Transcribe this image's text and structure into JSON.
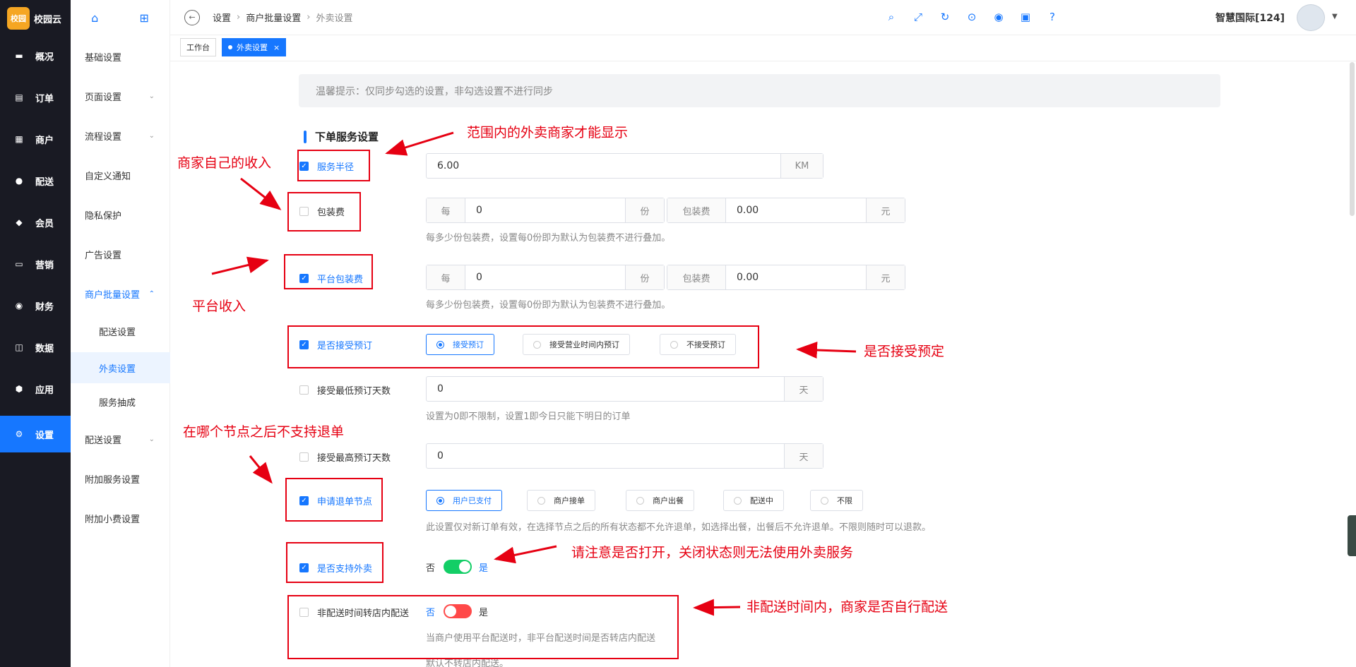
{
  "app": {
    "logo_mark": "校园",
    "name": "校园云"
  },
  "leftnav": [
    {
      "label": "概况",
      "icon": "monitor-icon"
    },
    {
      "label": "订单",
      "icon": "order-icon"
    },
    {
      "label": "商户",
      "icon": "store-icon"
    },
    {
      "label": "配送",
      "icon": "delivery-icon"
    },
    {
      "label": "会员",
      "icon": "member-icon"
    },
    {
      "label": "营销",
      "icon": "ticket-icon"
    },
    {
      "label": "财务",
      "icon": "money-icon"
    },
    {
      "label": "数据",
      "icon": "chart-icon"
    },
    {
      "label": "应用",
      "icon": "cube-icon"
    },
    {
      "label": "设置",
      "icon": "settings-icon",
      "active": true
    }
  ],
  "subnav": {
    "items": [
      {
        "label": "基础设置"
      },
      {
        "label": "页面设置"
      },
      {
        "label": "流程设置"
      },
      {
        "label": "自定义通知"
      },
      {
        "label": "隐私保护"
      },
      {
        "label": "广告设置"
      },
      {
        "label": "商户批量设置"
      },
      {
        "label": "配送设置"
      },
      {
        "label": "外卖设置"
      },
      {
        "label": "服务抽成"
      },
      {
        "label": "配送设置"
      },
      {
        "label": "附加服务设置"
      },
      {
        "label": "附加小费设置"
      }
    ]
  },
  "breadcrumb": {
    "items": [
      "设置",
      "商户批量设置",
      "外卖设置"
    ]
  },
  "header": {
    "user_name": "智慧国际[124]"
  },
  "tabs": [
    {
      "label": "工作台"
    },
    {
      "label": "外卖设置"
    }
  ],
  "tip": "温馨提示：仅同步勾选的设置，非勾选设置不进行同步",
  "section_title": "下单服务设置",
  "form": {
    "service_radius": {
      "label": "服务半径",
      "checked": true,
      "value": "6.00",
      "unit": "KM"
    },
    "packing_fee": {
      "label": "包装费",
      "checked": false,
      "per": "每",
      "count": "0",
      "count_unit": "份",
      "fee_label": "包装费",
      "fee": "0.00",
      "fee_unit": "元",
      "hint": "每多少份包装费，设置每0份即为默认为包装费不进行叠加。"
    },
    "platform_packing_fee": {
      "label": "平台包装费",
      "checked": true,
      "per": "每",
      "count": "0",
      "count_unit": "份",
      "fee_label": "包装费",
      "fee": "0.00",
      "fee_unit": "元",
      "hint": "每多少份包装费，设置每0份即为默认为包装费不进行叠加。"
    },
    "accept_reserve": {
      "label": "是否接受预订",
      "checked": true,
      "options": [
        "接受预订",
        "接受营业时间内预订",
        "不接受预订"
      ],
      "selected": 0
    },
    "min_reserve_days": {
      "label": "接受最低预订天数",
      "checked": false,
      "value": "0",
      "unit": "天",
      "hint": "设置为0即不限制，设置1即今日只能下明日的订单"
    },
    "max_reserve_days": {
      "label": "接受最高预订天数",
      "checked": false,
      "value": "0",
      "unit": "天"
    },
    "refund_node": {
      "label": "申请退单节点",
      "checked": true,
      "options": [
        "用户已支付",
        "商户接单",
        "商户出餐",
        "配送中",
        "不限"
      ],
      "selected": 0,
      "hint": "此设置仅对新订单有效，在选择节点之后的所有状态都不允许退单，如选择出餐，出餐后不允许退单。不限则随时可以退款。"
    },
    "support_takeout": {
      "label": "是否支持外卖",
      "checked": true,
      "off": "否",
      "on": "是",
      "state": "on"
    },
    "offhours_self_delivery": {
      "label": "非配送时间转店内配送",
      "checked": false,
      "off": "否",
      "on": "是",
      "state": "off",
      "hint": "当商户使用平台配送时，非平台配送时间是否转店内配送",
      "hint2": "默认不转店内配送。"
    }
  },
  "annotations": {
    "scope": "范围内的外卖商家才能显示",
    "merchant_income": "商家自己的收入",
    "platform_income": "平台收入",
    "reserve": "是否接受预定",
    "refund": "在哪个节点之后不支持退单",
    "takeout_notice": "请注意是否打开，关闭状态则无法使用外卖服务",
    "self_delivery": "非配送时间内，商家是否自行配送"
  },
  "colors": {
    "primary": "#1677ff",
    "nav_bg": "#191a23",
    "annotation": "#e60012",
    "switch_on": "#13ce66",
    "switch_off": "#ff4949"
  }
}
